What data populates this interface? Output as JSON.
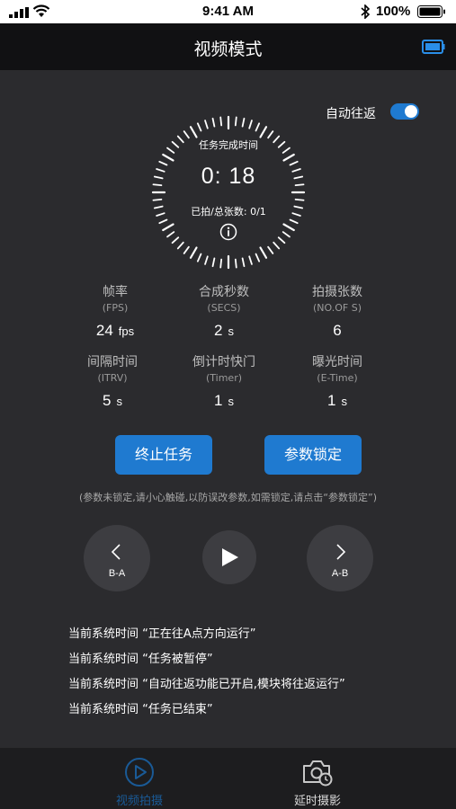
{
  "status_bar": {
    "time": "9:41 AM",
    "battery_pct": "100%"
  },
  "nav": {
    "title": "视频模式"
  },
  "toggle": {
    "label": "自动往返",
    "on": true
  },
  "dial": {
    "label": "任务完成时间",
    "time": "0:  18",
    "count": "已拍/总张数: 0/1"
  },
  "params": [
    {
      "name": "帧率",
      "en": "(FPS)",
      "value": "24",
      "unit": "fps"
    },
    {
      "name": "合成秒数",
      "en": "(SECS)",
      "value": "2",
      "unit": "s"
    },
    {
      "name": "拍摄张数",
      "en": "(NO.OF S)",
      "value": "6",
      "unit": ""
    },
    {
      "name": "间隔时间",
      "en": "(ITRV)",
      "value": "5",
      "unit": "s"
    },
    {
      "name": "倒计时快门",
      "en": "(Timer)",
      "value": "1",
      "unit": "s"
    },
    {
      "name": "曝光时间",
      "en": "(E-Time)",
      "value": "1",
      "unit": "s"
    }
  ],
  "buttons": {
    "stop": "终止任务",
    "lock": "参数锁定"
  },
  "hint": "(参数未锁定,请小心触碰,以防误改参数,如需锁定,请点击“参数锁定”)",
  "controls": {
    "back_label": "B-A",
    "forward_label": "A-B"
  },
  "logs": [
    "当前系统时间 “正在往A点方向运行”",
    "当前系统时间 “任务被暂停”",
    "当前系统时间 “自动往返功能已开启,模块将往返运行”",
    "当前系统时间 “任务已结束”"
  ],
  "tabs": [
    {
      "label": "视频拍摄",
      "active": true,
      "icon": "play-circle-icon"
    },
    {
      "label": "延时摄影",
      "active": false,
      "icon": "camera-timer-icon"
    }
  ],
  "colors": {
    "accent": "#1f7ad0",
    "background": "#2b2b2e",
    "nav": "#111113",
    "tab_active": "#1a5a96"
  }
}
